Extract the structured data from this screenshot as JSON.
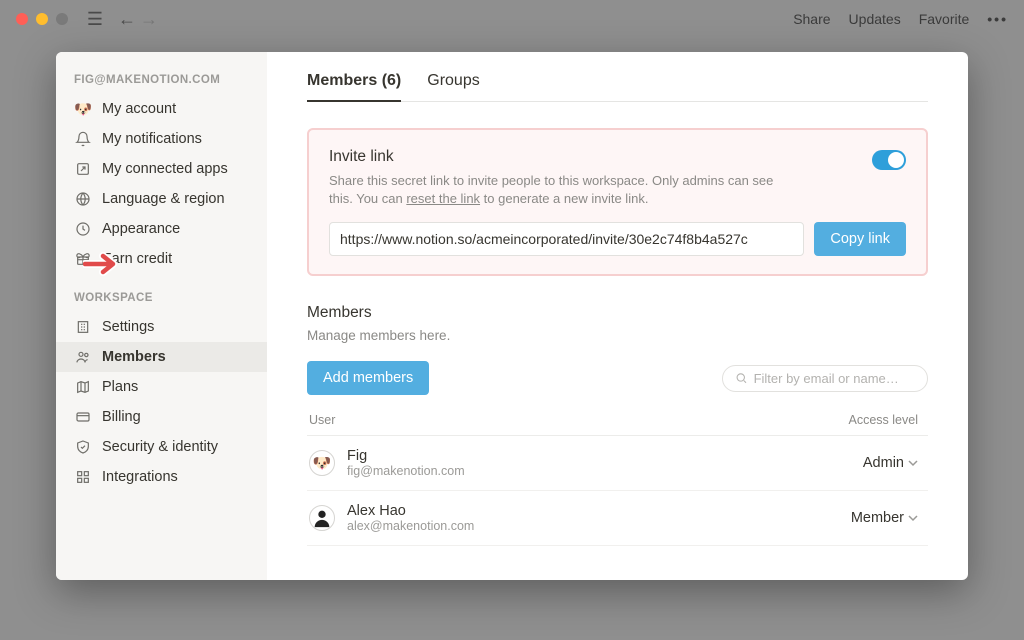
{
  "chrome": {
    "menu": {
      "share": "Share",
      "updates": "Updates",
      "favorite": "Favorite"
    }
  },
  "sidebar": {
    "account_section_label": "FIG@MAKENOTION.COM",
    "workspace_section_label": "WORKSPACE",
    "items": {
      "my_account": "My account",
      "my_notifications": "My notifications",
      "my_connected_apps": "My connected apps",
      "language_region": "Language & region",
      "appearance": "Appearance",
      "earn_credit": "Earn credit",
      "settings": "Settings",
      "members": "Members",
      "plans": "Plans",
      "billing": "Billing",
      "security_identity": "Security & identity",
      "integrations": "Integrations"
    }
  },
  "tabs": {
    "members": "Members (6)",
    "groups": "Groups"
  },
  "invite": {
    "title": "Invite link",
    "desc_pre": "Share this secret link to invite people to this workspace. Only admins can see this. You can ",
    "reset_text": "reset the link",
    "desc_post": " to generate a new invite link.",
    "url": "https://www.notion.so/acmeincorporated/invite/30e2c74f8b4a527c",
    "copy_label": "Copy link"
  },
  "members_section": {
    "title": "Members",
    "subtitle": "Manage members here.",
    "add_label": "Add members",
    "filter_placeholder": "Filter by email or name…",
    "col_user": "User",
    "col_access": "Access level"
  },
  "members": [
    {
      "name": "Fig",
      "email": "fig@makenotion.com",
      "access": "Admin",
      "avatar": "🐶"
    },
    {
      "name": "Alex Hao",
      "email": "alex@makenotion.com",
      "access": "Member",
      "avatar": "👤"
    }
  ]
}
